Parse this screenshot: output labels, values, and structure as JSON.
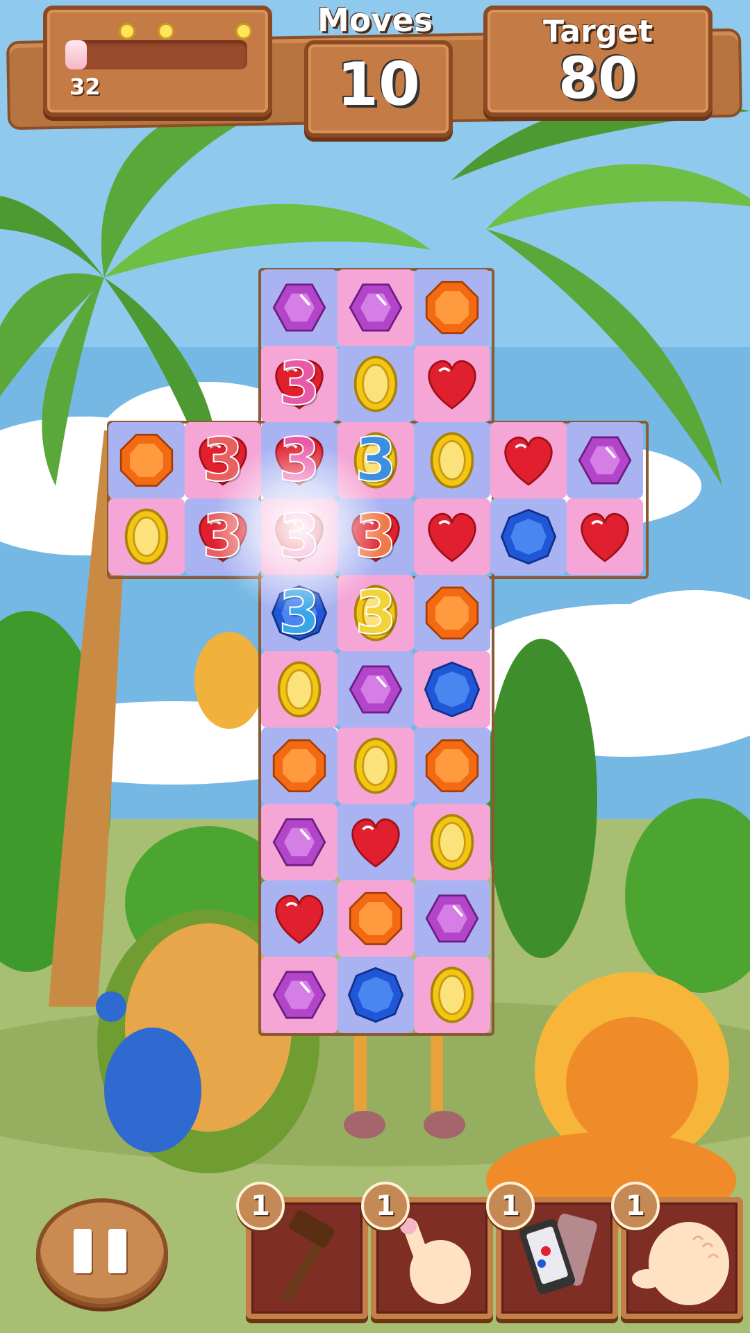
{
  "hud": {
    "score": "32",
    "score_progress": 0.12,
    "moves_label": "Moves",
    "moves_value": "10",
    "target_label": "Target",
    "target_value": "80"
  },
  "board": {
    "grid": [
      [
        null,
        null,
        "gem-purple",
        "gem-purple",
        "gem-orange",
        null,
        null
      ],
      [
        null,
        null,
        "heart-red",
        "coin-gold",
        "heart-red",
        null,
        null
      ],
      [
        "gem-orange",
        "heart-red",
        "heart-red",
        "coin-gold",
        "coin-gold",
        "heart-red",
        "gem-purple"
      ],
      [
        "coin-gold",
        "heart-red",
        "heart-red",
        "heart-red",
        "heart-red",
        "gem-blue",
        "heart-red"
      ],
      [
        null,
        null,
        "gem-blue",
        "coin-gold",
        "gem-orange",
        null,
        null
      ],
      [
        null,
        null,
        "coin-gold",
        "gem-purple",
        "gem-blue",
        null,
        null
      ],
      [
        null,
        null,
        "gem-orange",
        "coin-gold",
        "gem-orange",
        null,
        null
      ],
      [
        null,
        null,
        "gem-purple",
        "heart-red",
        "coin-gold",
        null,
        null
      ],
      [
        null,
        null,
        "heart-red",
        "gem-orange",
        "gem-purple",
        null,
        null
      ],
      [
        null,
        null,
        "gem-purple",
        "gem-blue",
        "coin-gold",
        null,
        null
      ]
    ],
    "bombs": [
      {
        "row": 1,
        "col": 2,
        "label": "3",
        "color": "#e85aa8"
      },
      {
        "row": 2,
        "col": 1,
        "label": "3",
        "color": "#e8605f"
      },
      {
        "row": 2,
        "col": 2,
        "label": "3",
        "color": "#e85aa8"
      },
      {
        "row": 2,
        "col": 3,
        "label": "3",
        "color": "#3a8fe0"
      },
      {
        "row": 3,
        "col": 1,
        "label": "3",
        "color": "#e8605f"
      },
      {
        "row": 3,
        "col": 2,
        "label": "3",
        "color": "#e85aa8"
      },
      {
        "row": 3,
        "col": 3,
        "label": "3",
        "color": "#f07a4a"
      },
      {
        "row": 4,
        "col": 2,
        "label": "3",
        "color": "#3aa5e8"
      },
      {
        "row": 4,
        "col": 3,
        "label": "3",
        "color": "#f2d43a"
      }
    ]
  },
  "boosters": [
    {
      "name": "hammer",
      "count": "1"
    },
    {
      "name": "finger-tap",
      "count": "1"
    },
    {
      "name": "phone-shuffle",
      "count": "1"
    },
    {
      "name": "hand-swap",
      "count": "1"
    }
  ],
  "colors": {
    "gem-purple": "#b245c9",
    "gem-orange": "#f46a12",
    "gem-blue": "#1f57d6",
    "heart-red": "#e0202e",
    "coin-gold": "#f2c612",
    "tile-pink": "#f5a6d6",
    "tile-blue": "#a9b3f2"
  }
}
